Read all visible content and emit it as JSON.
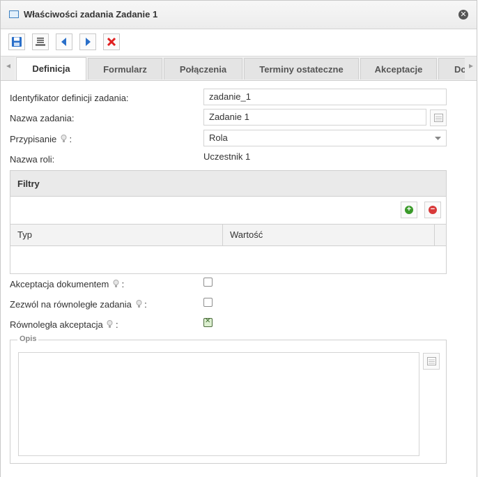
{
  "window": {
    "title": "Właściwości zadania Zadanie 1",
    "close_glyph": "✕",
    "title_icon": "window-icon"
  },
  "toolbar": {
    "buttons": [
      "save-icon",
      "list-icon",
      "prev-arrow-icon",
      "next-arrow-icon",
      "delete-icon"
    ]
  },
  "tabs": {
    "items": [
      {
        "label": "Definicja",
        "active": true
      },
      {
        "label": "Formularz",
        "active": false
      },
      {
        "label": "Połączenia",
        "active": false
      },
      {
        "label": "Terminy ostateczne",
        "active": false
      },
      {
        "label": "Akceptacje",
        "active": false
      },
      {
        "label": "Do",
        "active": false
      }
    ],
    "left_arrow": "◂",
    "right_arrow": "▸"
  },
  "form": {
    "task_id": {
      "label": "Identyfikator definicji zadania:",
      "value": "zadanie_1"
    },
    "task_name": {
      "label": "Nazwa zadania:",
      "value": "Zadanie 1"
    },
    "assignment": {
      "label": "Przypisanie",
      "suffix": ":",
      "value": "Rola"
    },
    "role_name": {
      "label": "Nazwa roli:",
      "value": "Uczestnik 1"
    }
  },
  "filters": {
    "title": "Filtry",
    "columns": [
      "Typ",
      "Wartość"
    ],
    "add_glyph": "+",
    "remove_glyph": "−"
  },
  "options": {
    "doc_acceptance": {
      "label": "Akceptacja dokumentem",
      "suffix": ":",
      "checked": false
    },
    "parallel_tasks": {
      "label": "Zezwól na równoległe zadania",
      "suffix": ":",
      "checked": false
    },
    "parallel_acceptance": {
      "label": "Równoległa akceptacja",
      "suffix": ":",
      "checked": true
    }
  },
  "description": {
    "legend": "Opis",
    "value": ""
  },
  "colors": {
    "accent_blue": "#2a6fc9",
    "delete_red": "#e02020",
    "add_green": "#3a9a2a",
    "remove_red": "#d83a3a"
  }
}
